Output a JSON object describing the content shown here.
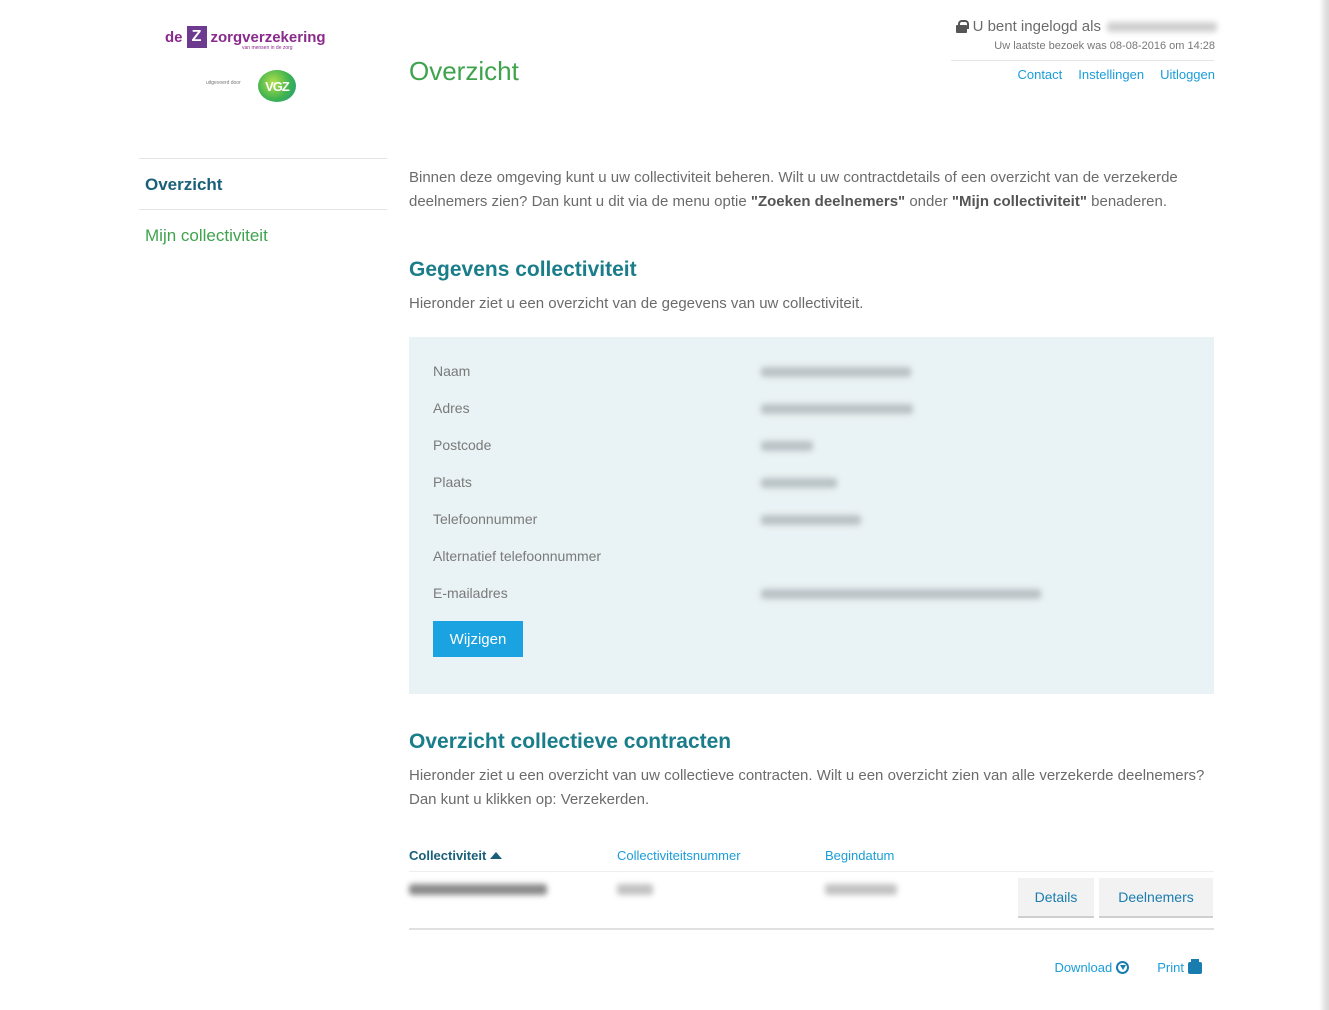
{
  "brand": {
    "prefix": "de",
    "box_letter": "Z",
    "name": "zorgverzekering",
    "tagline": "van mensen in de zorg",
    "sub_text": "uitgevoerd door",
    "partner": "VGZ",
    "colors": {
      "brand_purple": "#8a2a8c",
      "green": "#3fa34d",
      "blue": "#1a9dd9"
    }
  },
  "header": {
    "page_title": "Overzicht",
    "login_label": "U bent ingelogd als",
    "last_visit": "Uw laatste bezoek was 08-08-2016 om 14:28",
    "links": {
      "contact": "Contact",
      "settings": "Instellingen",
      "logout": "Uitloggen"
    }
  },
  "sidebar": {
    "items": [
      {
        "label": "Overzicht",
        "active": true
      },
      {
        "label": "Mijn collectiviteit",
        "active": false
      }
    ]
  },
  "intro": {
    "text_1": "Binnen deze omgeving kunt u uw collectiviteit beheren. Wilt u uw contractdetails of een overzicht van de verzekerde deelnemers zien? Dan kunt u dit via de menu optie ",
    "bold_1": "\"Zoeken deelnemers\"",
    "text_2": " onder ",
    "bold_2": "\"Mijn collectiviteit\"",
    "text_3": " benaderen."
  },
  "gegevens": {
    "title": "Gegevens collectiviteit",
    "subtitle": "Hieronder ziet u een overzicht van de gegevens van uw collectiviteit.",
    "fields": [
      {
        "label": "Naam"
      },
      {
        "label": "Adres"
      },
      {
        "label": "Postcode"
      },
      {
        "label": "Plaats"
      },
      {
        "label": "Telefoonnummer"
      },
      {
        "label": "Alternatief telefoonnummer"
      },
      {
        "label": "E-mailadres"
      }
    ],
    "edit_button": "Wijzigen"
  },
  "contracten": {
    "title": "Overzicht collectieve contracten",
    "subtitle": "Hieronder ziet u een overzicht van uw collectieve contracten. Wilt u een overzicht zien van alle verzekerde deelnemers? Dan kunt u klikken op: Verzekerden.",
    "columns": [
      "Collectiviteit",
      "Collectiviteitsnummer",
      "Begindatum"
    ],
    "row_buttons": {
      "details": "Details",
      "participants": "Deelnemers"
    }
  },
  "footer": {
    "download": "Download",
    "print": "Print"
  }
}
